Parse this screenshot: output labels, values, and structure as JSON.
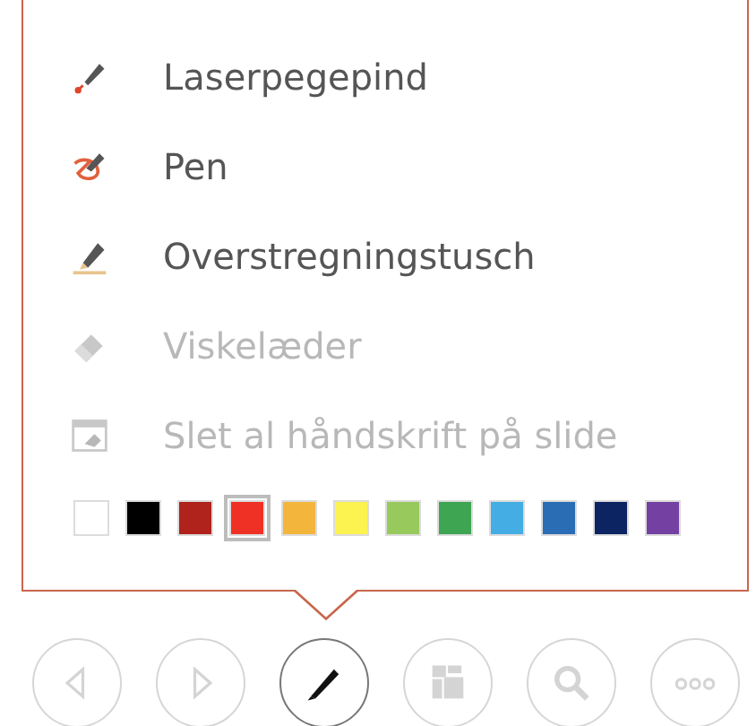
{
  "menu": [
    {
      "kind": "laser",
      "label": "Laserpegepind",
      "disabled": false
    },
    {
      "kind": "pen",
      "label": "Pen",
      "disabled": false
    },
    {
      "kind": "highlighter",
      "label": "Overstregningstusch",
      "disabled": false
    },
    {
      "kind": "eraser",
      "label": "Viskelæder",
      "disabled": true
    },
    {
      "kind": "clear",
      "label": "Slet al håndskrift på slide",
      "disabled": true
    }
  ],
  "colors": [
    {
      "color": "#ffffff",
      "selected": false
    },
    {
      "color": "#000000",
      "selected": false
    },
    {
      "color": "#b0231c",
      "selected": false
    },
    {
      "color": "#ee3124",
      "selected": true
    },
    {
      "color": "#f4b53d",
      "selected": false
    },
    {
      "color": "#fcf350",
      "selected": false
    },
    {
      "color": "#98c95c",
      "selected": false
    },
    {
      "color": "#3ea653",
      "selected": false
    },
    {
      "color": "#44ade4",
      "selected": false
    },
    {
      "color": "#2a6db5",
      "selected": false
    },
    {
      "color": "#0c2462",
      "selected": false
    },
    {
      "color": "#7440a2",
      "selected": false
    }
  ],
  "toolbar": [
    {
      "kind": "previous",
      "active": false
    },
    {
      "kind": "next",
      "active": false
    },
    {
      "kind": "pen",
      "active": true
    },
    {
      "kind": "slides",
      "active": false
    },
    {
      "kind": "zoom",
      "active": false
    },
    {
      "kind": "more",
      "active": false
    }
  ]
}
